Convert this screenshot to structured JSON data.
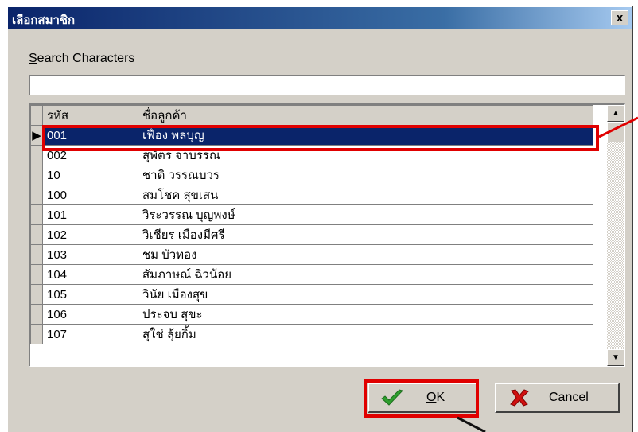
{
  "dialog": {
    "title": "เลือกสมาชิก",
    "close_label": "x"
  },
  "search": {
    "label_first": "S",
    "label_rest": "earch Characters",
    "value": ""
  },
  "grid": {
    "columns": {
      "code": "รหัส",
      "name": "ชื่อลูกค้า"
    },
    "current_row_marker": "▶",
    "rows": [
      {
        "code": "001",
        "name": "เฟื่อง  พลบุญ"
      },
      {
        "code": "002",
        "name": "สุพัตร จาบรรณ"
      },
      {
        "code": "10",
        "name": "ชาติ  วรรณบวร"
      },
      {
        "code": "100",
        "name": "สมโชค  สุขเสน"
      },
      {
        "code": "101",
        "name": "วิระวรรณ  บุญพงษ์"
      },
      {
        "code": "102",
        "name": "วิเชียร  เมืองมีศรี"
      },
      {
        "code": "103",
        "name": "ชม  บัวทอง"
      },
      {
        "code": "104",
        "name": "สัมภาษณ์  ฉิวน้อย"
      },
      {
        "code": "105",
        "name": "วินัย  เมืองสุข"
      },
      {
        "code": "106",
        "name": "ประจบ  สุขะ"
      },
      {
        "code": "107",
        "name": "สุใช่  ลุ้ยกิ้ม"
      }
    ],
    "scroll_up": "▲",
    "scroll_down": "▼"
  },
  "buttons": {
    "ok_first": "O",
    "ok_rest": "K",
    "cancel": "Cancel"
  },
  "colors": {
    "highlight": "#e00000",
    "selection": "#0a246a",
    "ok_check": "#2e9e2e",
    "cancel_x": "#d01010"
  }
}
